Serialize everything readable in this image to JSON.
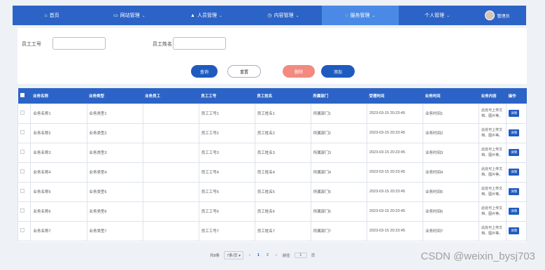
{
  "nav": {
    "items": [
      {
        "label": "首页",
        "icon": "home-icon",
        "glyph": "⌂",
        "active": false
      },
      {
        "label": "网站管理",
        "icon": "monitor-icon",
        "glyph": "▭",
        "active": false
      },
      {
        "label": "人员管理",
        "icon": "person-icon",
        "glyph": "▲",
        "active": false
      },
      {
        "label": "内容管理",
        "icon": "clock-icon",
        "glyph": "◷",
        "active": false
      },
      {
        "label": "服务管理",
        "icon": "chat-icon",
        "glyph": "◌",
        "active": true
      },
      {
        "label": "个人管理",
        "icon": "",
        "glyph": "",
        "active": false
      }
    ],
    "user": {
      "name": "管理员"
    }
  },
  "search": {
    "employee_no_label": "员工工号",
    "employee_name_label": "员工姓名",
    "employee_no_value": "",
    "employee_name_value": "",
    "query_label": "查询",
    "reset_label": "重置",
    "delete_label": "删除",
    "add_label": "添加"
  },
  "table": {
    "headers": [
      "业务名称",
      "业务类型",
      "业务员工",
      "员工工号",
      "员工姓名",
      "所属部门",
      "受理时间",
      "业务时间",
      "业务内容",
      "操作"
    ],
    "detail_label": "详情",
    "rows": [
      [
        "业务名称1",
        "业务类型1",
        "",
        "员工工号1",
        "员工姓名1",
        "所属部门1",
        "2023-03-15 20:23:45",
        "业务时间1",
        "此处可上传文档、图片等。"
      ],
      [
        "业务名称2",
        "业务类型2",
        "",
        "员工工号2",
        "员工姓名2",
        "所属部门2",
        "2023-03-15 20:23:45",
        "业务时间2",
        "此处可上传文档、图片等。"
      ],
      [
        "业务名称3",
        "业务类型3",
        "",
        "员工工号3",
        "员工姓名3",
        "所属部门3",
        "2023-03-15 20:23:45",
        "业务时间3",
        "此处可上传文档、图片等。"
      ],
      [
        "业务名称4",
        "业务类型4",
        "",
        "员工工号4",
        "员工姓名4",
        "所属部门4",
        "2023-03-15 20:23:45",
        "业务时间4",
        "此处可上传文档、图片等。"
      ],
      [
        "业务名称5",
        "业务类型5",
        "",
        "员工工号5",
        "员工姓名5",
        "所属部门5",
        "2023-03-15 20:23:45",
        "业务时间5",
        "此处可上传文档、图片等。"
      ],
      [
        "业务名称6",
        "业务类型6",
        "",
        "员工工号6",
        "员工姓名6",
        "所属部门6",
        "2023-03-15 20:23:45",
        "业务时间6",
        "此处可上传文档、图片等。"
      ],
      [
        "业务名称7",
        "业务类型7",
        "",
        "员工工号7",
        "员工姓名7",
        "所属部门7",
        "2023-03-15 20:23:45",
        "业务时间7",
        "此处可上传文档、图片等。"
      ]
    ]
  },
  "pager": {
    "total": "共8条",
    "page_size": "7条/页",
    "prev": "‹",
    "pages": [
      "1",
      "2"
    ],
    "current": "1",
    "next": "›",
    "goto_label": "前往",
    "goto_value": "1",
    "page_suffix": "页"
  },
  "watermark": "CSDN @weixin_bysj703"
}
